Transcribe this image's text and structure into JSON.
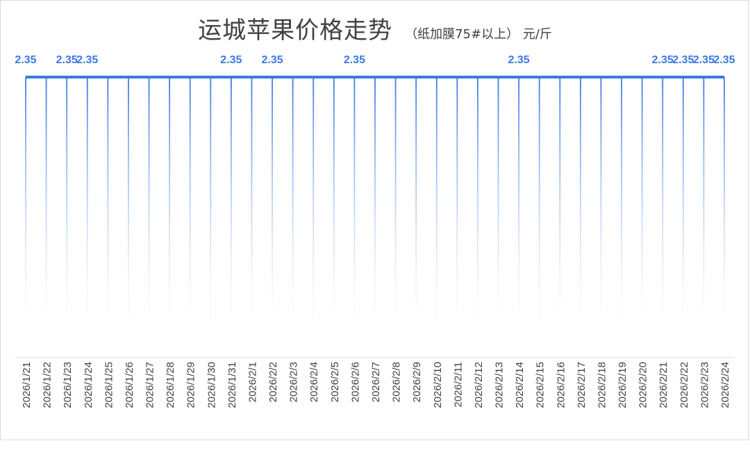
{
  "chart_data": {
    "type": "area",
    "title": "运城苹果价格走势",
    "subtitle": "（纸加膜75#以上） 元/斤",
    "xlabel": "",
    "ylabel": "",
    "categories": [
      "2026/1/21",
      "2026/1/22",
      "2026/1/23",
      "2026/1/24",
      "2026/1/25",
      "2026/1/26",
      "2026/1/27",
      "2026/1/28",
      "2026/1/29",
      "2026/1/30",
      "2026/1/31",
      "2026/2/1",
      "2026/2/2",
      "2026/2/3",
      "2026/2/4",
      "2026/2/5",
      "2026/2/6",
      "2026/2/7",
      "2026/2/8",
      "2026/2/9",
      "2026/2/10",
      "2026/2/11",
      "2026/2/12",
      "2026/2/13",
      "2026/2/14",
      "2026/2/15",
      "2026/2/16",
      "2026/2/17",
      "2026/2/18",
      "2026/2/19",
      "2026/2/20",
      "2026/2/21",
      "2026/2/22",
      "2026/2/23",
      "2026/2/24"
    ],
    "values": [
      2.35,
      2.35,
      2.35,
      2.35,
      2.35,
      2.35,
      2.35,
      2.35,
      2.35,
      2.35,
      2.35,
      2.35,
      2.35,
      2.35,
      2.35,
      2.35,
      2.35,
      2.35,
      2.35,
      2.35,
      2.35,
      2.35,
      2.35,
      2.35,
      2.35,
      2.35,
      2.35,
      2.35,
      2.35,
      2.35,
      2.35,
      2.35,
      2.35,
      2.35,
      2.35
    ],
    "labeled_indices": [
      0,
      2,
      3,
      10,
      12,
      16,
      24,
      31,
      32,
      33,
      34
    ],
    "data_labels": [
      "2.35",
      "2.35",
      "2.35",
      "2.35",
      "2.35",
      "2.35",
      "2.35",
      "2.35",
      "2.35",
      "2.35",
      "2.35"
    ],
    "ylim": [
      0,
      2.35
    ],
    "grid": false,
    "legend": "none",
    "color": "#3b78e0"
  }
}
